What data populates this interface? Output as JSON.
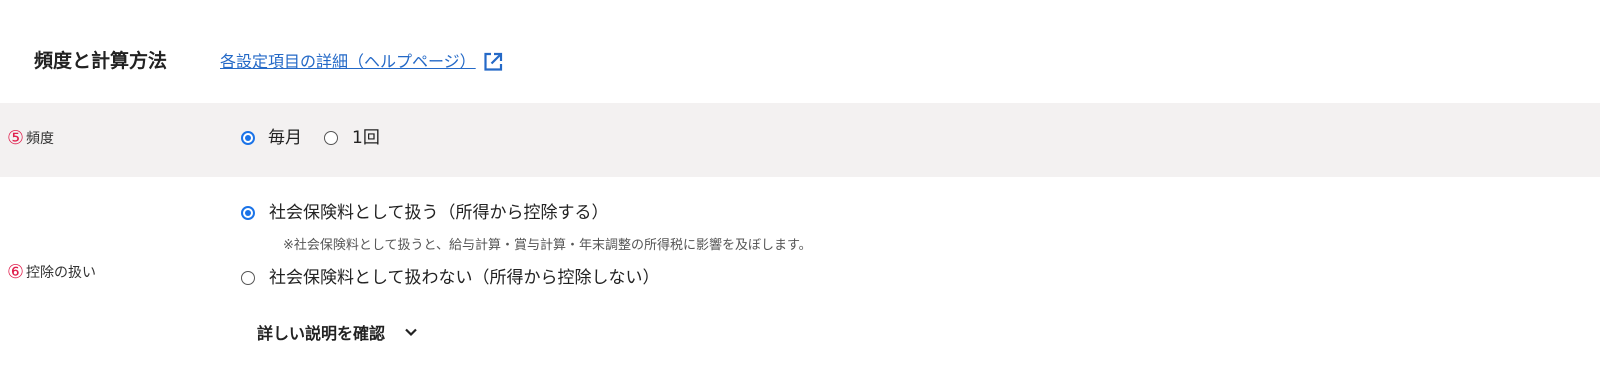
{
  "section": {
    "title": "頻度と計算方法",
    "help_link_label": "各設定項目の詳細（ヘルプページ）"
  },
  "frequency": {
    "number": "⑤",
    "label": "頻度",
    "options": [
      {
        "label": "毎月",
        "checked": true
      },
      {
        "label": "1回",
        "checked": false
      }
    ]
  },
  "deduction": {
    "number": "⑥",
    "label": "控除の扱い",
    "options": [
      {
        "label": "社会保険料として扱う（所得から控除する）",
        "checked": true
      },
      {
        "label": "社会保険料として扱わない（所得から控除しない）",
        "checked": false
      }
    ],
    "note": "※社会保険料として扱うと、給与計算・賞与計算・年末調整の所得税に影響を及ぼします。",
    "details_label": "詳しい説明を確認"
  },
  "colors": {
    "accent": "#1a73e8",
    "link": "#2469c7",
    "number_marker": "#e0204e",
    "row_shade": "#f3f1f1"
  }
}
